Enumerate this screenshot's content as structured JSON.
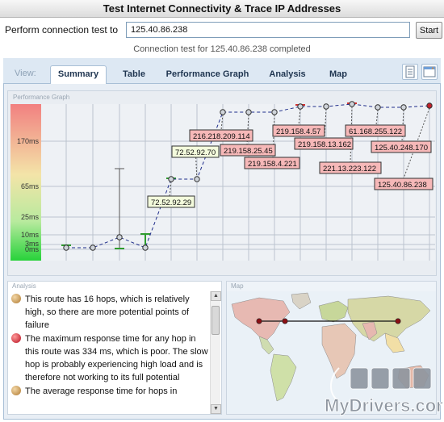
{
  "window": {
    "title": "Test Internet Connectivity & Trace IP Addresses"
  },
  "test": {
    "label": "Perform connection test to",
    "target": "125.40.86.238",
    "start_label": "Start",
    "status": "Connection test for 125.40.86.238 completed"
  },
  "tabs": {
    "view_label": "View:",
    "items": [
      "Summary",
      "Table",
      "Performance Graph",
      "Analysis",
      "Map"
    ],
    "active": "Summary"
  },
  "graph": {
    "panel_title": "Performance Graph",
    "y_ticks": [
      "170ms",
      "65ms",
      "25ms",
      "10ms",
      "3ms",
      "0ms"
    ],
    "hop_labels": [
      {
        "text": "72.52.92.29",
        "highlight": "green"
      },
      {
        "text": "72.52.92.70",
        "highlight": "green"
      },
      {
        "text": "216.218.209.114",
        "highlight": "red"
      },
      {
        "text": "219.158.25.45",
        "highlight": "red"
      },
      {
        "text": "219.158.4.221",
        "highlight": "red"
      },
      {
        "text": "219.158.4.57",
        "highlight": "red"
      },
      {
        "text": "219.158.13.162",
        "highlight": "red"
      },
      {
        "text": "221.13.223.122",
        "highlight": "red"
      },
      {
        "text": "61.168.255.122",
        "highlight": "red"
      },
      {
        "text": "125.40.248.170",
        "highlight": "red"
      },
      {
        "text": "125.40.86.238",
        "highlight": "red"
      }
    ]
  },
  "analysis": {
    "panel_title": "Analysis",
    "items": [
      {
        "text": "This route has 16 hops, which is relatively high, so there are more potential points of failure",
        "status_color": "#c8944a"
      },
      {
        "text": "The maximum response time for any hop in this route was 334 ms, which is poor. The slow hop is probably experiencing high load and is therefore not working to its full potential",
        "status_color": "#d02030"
      },
      {
        "text": "The average response time for hops in",
        "status_color": "#c8944a"
      }
    ]
  },
  "map": {
    "panel_title": "Map"
  },
  "watermark": {
    "text": "MyDrivers.com"
  },
  "colors": {
    "accent": "#1f3550",
    "good": "#2e9c2e",
    "bad": "#d03030"
  }
}
